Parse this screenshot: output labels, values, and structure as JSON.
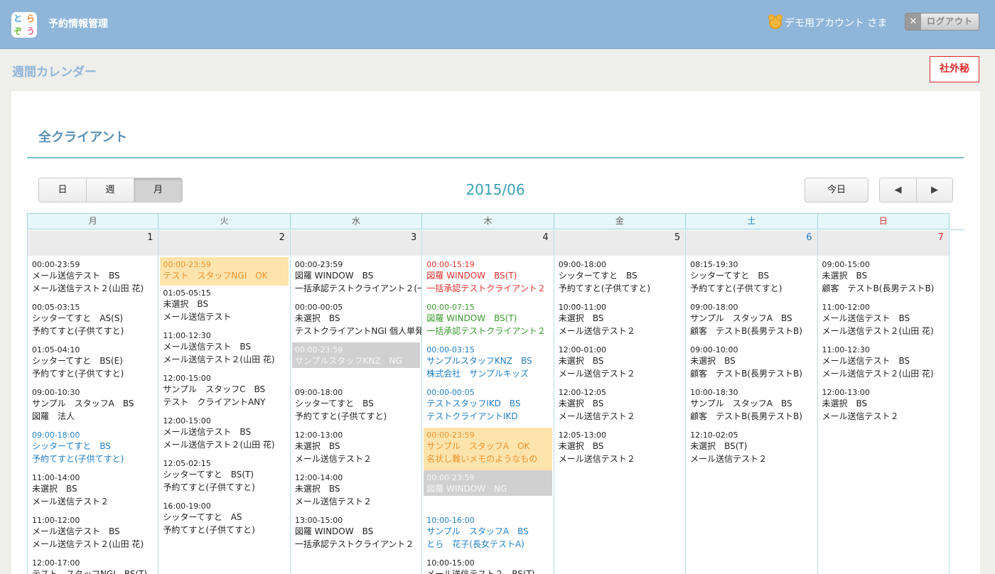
{
  "header": {
    "logo_chars": [
      "と",
      "ら",
      "ぞ",
      "う"
    ],
    "app_title": "予約情報管理",
    "account": "デモ用アカウント さま",
    "logout_x": "✕",
    "logout": "ログアウト"
  },
  "page_heading": "週間カレンダー",
  "confidential": "社外秘",
  "client_title": "全クライアント",
  "view_buttons": [
    "日",
    "週",
    "月"
  ],
  "active_view": "月",
  "month_label": "2015/06",
  "today_button": "今日",
  "nav": {
    "prev": "◀",
    "next": "▶"
  },
  "colors": {
    "header": "#8fb6d9",
    "accent": "#3ba0b5",
    "blue_event": "#1f7ec4",
    "red_event": "#e0302c",
    "green_event": "#3a9a2e",
    "orange_event": "#f0962e",
    "orange_bg": "#fde3ac",
    "gray_bg": "#d0d0d0"
  },
  "days_of_week": [
    "月",
    "火",
    "水",
    "木",
    "金",
    "土",
    "日"
  ],
  "days": [
    {
      "num": "1",
      "events": [
        {
          "time": "00:00-23:59",
          "line1": "メール送信テスト　BS",
          "line2": "メール送信テスト２(山田 花)"
        },
        {
          "time": "00:05-03:15",
          "line1": "シッターてすと　AS(S)",
          "line2": "予約てすと(子供てすと)"
        },
        {
          "time": "01:05-04:10",
          "line1": "シッターてすと　BS(E)",
          "line2": "予約てすと(子供てすと)"
        },
        {
          "time": "09:00-10:30",
          "line1": "サンプル　スタッフA　BS",
          "line2": "図羅　法人"
        },
        {
          "time": "09:00-18:00",
          "line1": "シッターてすと　BS",
          "line2": "予約てすと(子供てすと)",
          "style": "blue"
        },
        {
          "time": "11:00-14:00",
          "line1": "未選択　BS",
          "line2": "メール送信テスト２"
        },
        {
          "time": "11:00-12:00",
          "line1": "メール送信テスト　BS",
          "line2": "メール送信テスト２(山田 花)"
        },
        {
          "time": "12:00-17:00",
          "line1": "テスト　スタッフNGI　BS(T)",
          "line2": ""
        }
      ]
    },
    {
      "num": "2",
      "events": [
        {
          "time": "00:00-23:59",
          "line1": "テスト　スタッフNGI　OK",
          "line2": "",
          "style": "hl-orange"
        },
        {
          "time": "01:05-05:15",
          "line1": "未選択　BS",
          "line2": "メール送信テスト"
        },
        {
          "time": "11:00-12:30",
          "line1": "メール送信テスト　BS",
          "line2": "メール送信テスト２(山田 花)"
        },
        {
          "time": "12:00-15:00",
          "line1": "サンプル　スタッフC　BS",
          "line2": "テスト　クライアントANY"
        },
        {
          "time": "12:00-15:00",
          "line1": "メール送信テスト　BS",
          "line2": "メール送信テスト２(山田 花)"
        },
        {
          "time": "12:05-02:15",
          "line1": "シッターてすと　BS(T)",
          "line2": "予約てすと(子供てすと)"
        },
        {
          "time": "16:00-19:00",
          "line1": "シッターてすと　AS",
          "line2": "予約てすと(子供てすと)"
        }
      ]
    },
    {
      "num": "3",
      "events": [
        {
          "time": "00:00-23:59",
          "line1": "図羅 WINDOW　BS",
          "line2": "一括承認テストクライアント２(一"
        },
        {
          "time": "00:00-00:05",
          "line1": "未選択　BS",
          "line2": "テストクライアントNGI 個人単発"
        },
        {
          "time": "00:00-23:59",
          "line1": "サンプルスタッフKNZ　NG",
          "line2": "",
          "style": "hl-gray"
        },
        {
          "time": "09:00-18:00",
          "line1": "シッターてすと　BS",
          "line2": "予約てすと(子供てすと)"
        },
        {
          "time": "12:00-13:00",
          "line1": "未選択　BS",
          "line2": "メール送信テスト２"
        },
        {
          "time": "12:00-14:00",
          "line1": "未選択　BS",
          "line2": "メール送信テスト２"
        },
        {
          "time": "13:00-15:00",
          "line1": "図羅 WINDOW　BS",
          "line2": "一括承認テストクライアント２"
        }
      ]
    },
    {
      "num": "4",
      "events": [
        {
          "time": "00:00-15:19",
          "line1": "図羅 WINDOW　BS(T)",
          "line2": "一括承認テストクライアント２",
          "style": "red"
        },
        {
          "time": "00:00-07:15",
          "line1": "図羅 WINDOW　BS(T)",
          "line2": "一括承認テストクライアント２",
          "style": "green"
        },
        {
          "time": "00:00-03:15",
          "line1": "サンプルスタッフKNZ　BS",
          "line2": "株式会社　サンプルキッズ",
          "style": "blue"
        },
        {
          "time": "00:00-00:05",
          "line1": "テストスタッフIKD　BS",
          "line2": "テストクライアントIKD",
          "style": "blue"
        },
        {
          "time": "00:00-23:59",
          "line1": "サンプル　スタッフA　OK",
          "line2": "名状し難いメモのようなもの",
          "style": "hl-orange"
        },
        {
          "time": "00:00-23:59",
          "line1": "図羅 WINDOW　NG",
          "line2": "",
          "style": "hl-gray"
        },
        {
          "time": "10:00-16:00",
          "line1": "サンプル　スタッフA　BS",
          "line2": "とら　花子(長女テストA)",
          "style": "blue"
        },
        {
          "time": "10:00-15:00",
          "line1": "メール送信テスト２　BS(T)",
          "line2": ""
        }
      ]
    },
    {
      "num": "5",
      "events": [
        {
          "time": "09:00-18:00",
          "line1": "シッターてすと　BS",
          "line2": "予約てすと(子供てすと)"
        },
        {
          "time": "10:00-11:00",
          "line1": "未選択　BS",
          "line2": "メール送信テスト２"
        },
        {
          "time": "12:00-01:00",
          "line1": "未選択　BS",
          "line2": "メール送信テスト２"
        },
        {
          "time": "12:00-12:05",
          "line1": "未選択　BS",
          "line2": "メール送信テスト２"
        },
        {
          "time": "12:05-13:00",
          "line1": "未選択　BS",
          "line2": "メール送信テスト２"
        }
      ]
    },
    {
      "num": "6",
      "sat": true,
      "events": [
        {
          "time": "08:15-19:30",
          "line1": "シッターてすと　BS",
          "line2": "予約てすと(子供てすと)"
        },
        {
          "time": "09:00-18:00",
          "line1": "サンプル　スタッフA　BS",
          "line2": "顧客　テストB(長男テストB)"
        },
        {
          "time": "09:00-10:00",
          "line1": "未選択　BS",
          "line2": "顧客　テストB(長男テストB)"
        },
        {
          "time": "10:00-18:30",
          "line1": "サンプル　スタッフA　BS",
          "line2": "顧客　テストB(長男テストB)"
        },
        {
          "time": "12:10-02:05",
          "line1": "未選択　BS(T)",
          "line2": "メール送信テスト２"
        }
      ]
    },
    {
      "num": "7",
      "sun": true,
      "events": [
        {
          "time": "09:00-15:00",
          "line1": "未選択　BS",
          "line2": "顧客　テストB(長男テストB)"
        },
        {
          "time": "11:00-12:00",
          "line1": "メール送信テスト　BS",
          "line2": "メール送信テスト２(山田 花)"
        },
        {
          "time": "11:00-12:30",
          "line1": "メール送信テスト　BS",
          "line2": "メール送信テスト２(山田 花)"
        },
        {
          "time": "12:00-13:00",
          "line1": "未選択　BS",
          "line2": "メール送信テスト２"
        }
      ]
    }
  ]
}
